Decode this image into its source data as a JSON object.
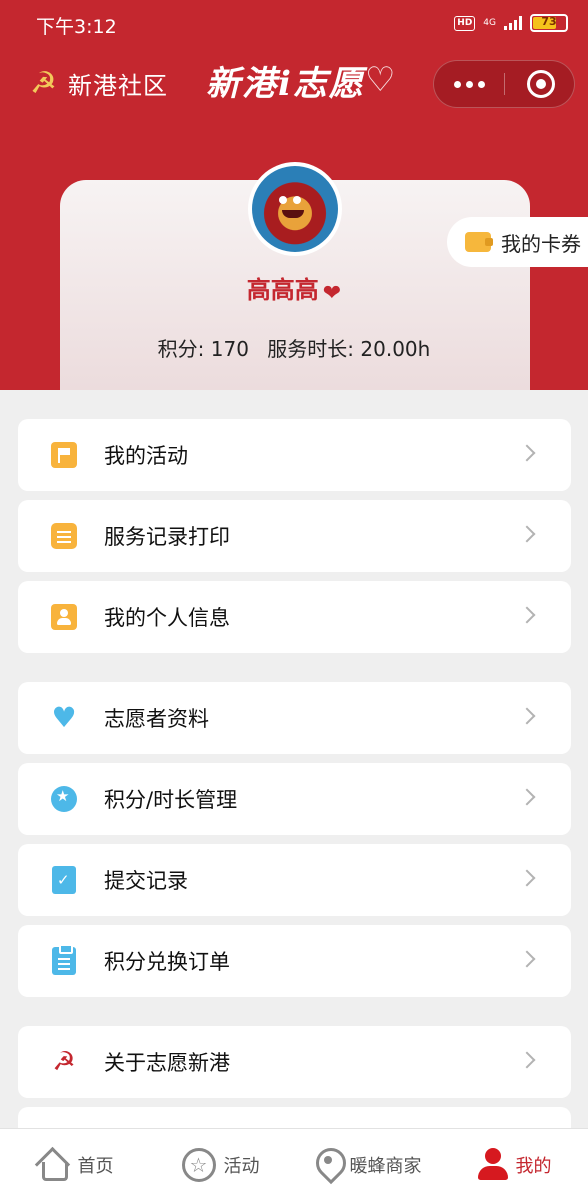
{
  "status_bar": {
    "time": "下午3:12",
    "hd": "HD",
    "network": "4G",
    "battery": "73"
  },
  "nav": {
    "community": "新港社区",
    "brand": "新港i志愿"
  },
  "profile": {
    "username": "高高高",
    "points_label": "积分: 170",
    "hours_label": "服务时长: 20.00h"
  },
  "coupon": {
    "label": "我的卡券"
  },
  "menu_groups": [
    {
      "items": [
        {
          "label": "我的活动",
          "icon": "flag-icon"
        },
        {
          "label": "服务记录打印",
          "icon": "notepad-icon"
        },
        {
          "label": "我的个人信息",
          "icon": "contact-card-icon"
        }
      ]
    },
    {
      "items": [
        {
          "label": "志愿者资料",
          "icon": "heart-icon"
        },
        {
          "label": "积分/时长管理",
          "icon": "medal-icon"
        },
        {
          "label": "提交记录",
          "icon": "document-check-icon"
        },
        {
          "label": "积分兑换订单",
          "icon": "clipboard-icon"
        }
      ]
    },
    {
      "items": [
        {
          "label": "关于志愿新港",
          "icon": "party-emblem-icon"
        }
      ]
    }
  ],
  "tabbar": {
    "tabs": [
      {
        "label": "首页",
        "icon": "home-icon"
      },
      {
        "label": "活动",
        "icon": "star-icon"
      },
      {
        "label": "暖蜂商家",
        "icon": "location-pin-icon"
      },
      {
        "label": "我的",
        "icon": "user-icon",
        "active": true
      }
    ]
  },
  "colors": {
    "brand_red": "#c4272f",
    "accent_yellow": "#f8b33c",
    "accent_blue": "#4db8e8"
  }
}
